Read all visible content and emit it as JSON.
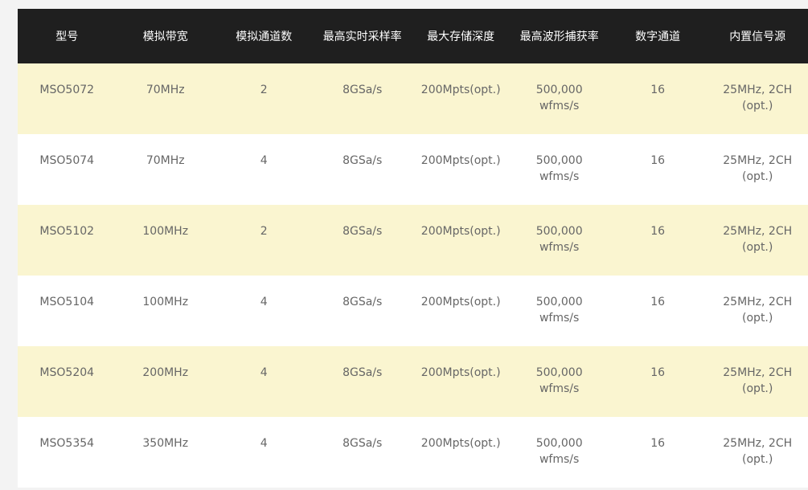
{
  "table": {
    "headers": [
      "型号",
      "模拟带宽",
      "模拟通道数",
      "最高实时采样率",
      "最大存储深度",
      "最高波形捕获率",
      "数字通道",
      "内置信号源"
    ],
    "rows": [
      [
        "MSO5072",
        "70MHz",
        "2",
        "8GSa/s",
        "200Mpts(opt.)",
        "500,000\nwfms/s",
        "16",
        "25MHz, 2CH\n(opt.)"
      ],
      [
        "MSO5074",
        "70MHz",
        "4",
        "8GSa/s",
        "200Mpts(opt.)",
        "500,000\nwfms/s",
        "16",
        "25MHz, 2CH\n(opt.)"
      ],
      [
        "MSO5102",
        "100MHz",
        "2",
        "8GSa/s",
        "200Mpts(opt.)",
        "500,000\nwfms/s",
        "16",
        "25MHz, 2CH\n(opt.)"
      ],
      [
        "MSO5104",
        "100MHz",
        "4",
        "8GSa/s",
        "200Mpts(opt.)",
        "500,000\nwfms/s",
        "16",
        "25MHz, 2CH\n(opt.)"
      ],
      [
        "MSO5204",
        "200MHz",
        "4",
        "8GSa/s",
        "200Mpts(opt.)",
        "500,000\nwfms/s",
        "16",
        "25MHz, 2CH\n(opt.)"
      ],
      [
        "MSO5354",
        "350MHz",
        "4",
        "8GSa/s",
        "200Mpts(opt.)",
        "500,000\nwfms/s",
        "16",
        "25MHz, 2CH\n(opt.)"
      ]
    ]
  },
  "colors": {
    "header_bg": "#1f1f1f",
    "header_text": "#ffffff",
    "row_highlight": "#faf5d0",
    "row_plain": "#ffffff",
    "cell_text": "#666666"
  }
}
